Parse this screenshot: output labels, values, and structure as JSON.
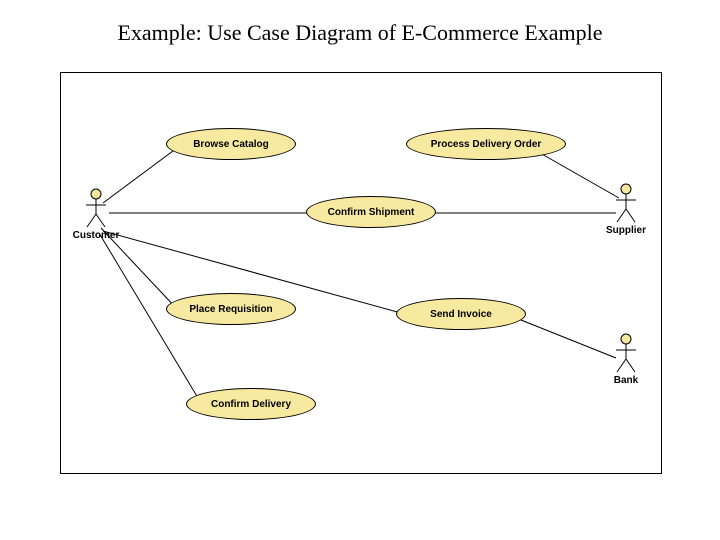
{
  "title": "Example: Use Case Diagram of E-Commerce Example",
  "actors": {
    "customer": {
      "name": "Customer"
    },
    "supplier": {
      "name": "Supplier"
    },
    "bank": {
      "name": "Bank"
    }
  },
  "usecases": {
    "browse_catalog": "Browse Catalog",
    "process_delivery_order": "Process Delivery Order",
    "confirm_shipment": "Confirm Shipment",
    "place_requisition": "Place Requisition",
    "send_invoice": "Send Invoice",
    "confirm_delivery": "Confirm Delivery"
  },
  "associations": [
    [
      "customer",
      "browse_catalog"
    ],
    [
      "customer",
      "confirm_shipment"
    ],
    [
      "customer",
      "place_requisition"
    ],
    [
      "customer",
      "send_invoice"
    ],
    [
      "customer",
      "confirm_delivery"
    ],
    [
      "supplier",
      "process_delivery_order"
    ],
    [
      "supplier",
      "confirm_shipment"
    ],
    [
      "bank",
      "send_invoice"
    ]
  ]
}
